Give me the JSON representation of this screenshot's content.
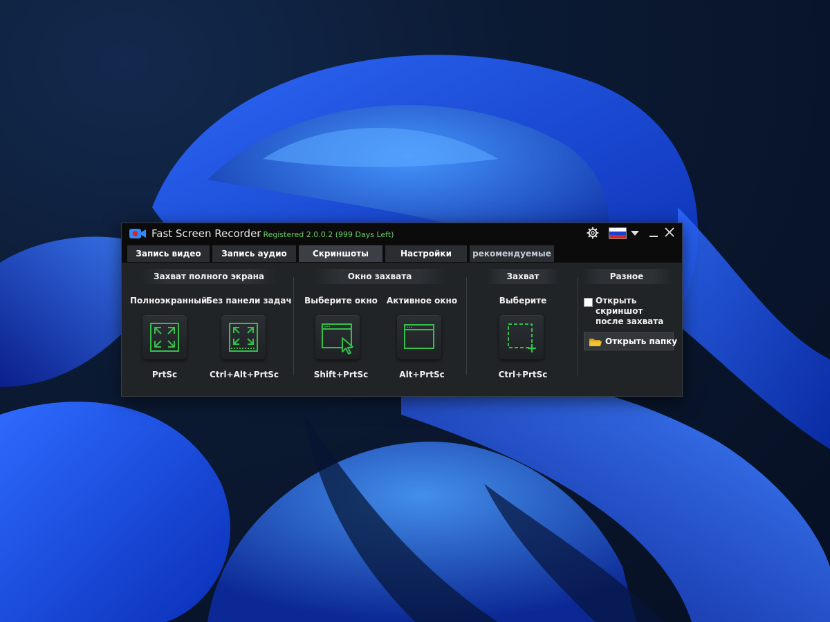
{
  "app": {
    "title": "Fast Screen Recorder",
    "registration": "- Registered 2.0.0.2 (999 Days Left)",
    "language": "Russian"
  },
  "tabs": [
    {
      "label": "Запись видео",
      "active": false
    },
    {
      "label": "Запись аудио",
      "active": false
    },
    {
      "label": "Скриншоты",
      "active": true
    },
    {
      "label": "Настройки",
      "active": false
    },
    {
      "label": "рекомендуемые",
      "active": false
    }
  ],
  "sections": {
    "fullscreen": {
      "heading": "Захват полного экрана",
      "items": [
        {
          "label": "Полноэкранный",
          "hotkey": "PrtSc",
          "icon": "fullscreen-expand-icon"
        },
        {
          "label": "Без панели задач",
          "hotkey": "Ctrl+Alt+PrtSc",
          "icon": "fullscreen-no-taskbar-icon"
        }
      ]
    },
    "window": {
      "heading": "Окно захвата",
      "items": [
        {
          "label": "Выберите окно",
          "hotkey": "Shift+PrtSc",
          "icon": "select-window-icon"
        },
        {
          "label": "Активное окно",
          "hotkey": "Alt+PrtSc",
          "icon": "active-window-icon"
        }
      ]
    },
    "region": {
      "heading": "Захват",
      "items": [
        {
          "label": "Выберите",
          "hotkey": "Ctrl+PrtSc",
          "icon": "select-region-icon"
        }
      ]
    },
    "misc": {
      "heading": "Разное",
      "open_after_capture_label": "Открыть скриншот после захвата",
      "open_after_capture_checked": false,
      "open_folder_label": "Открыть папку"
    }
  },
  "colors": {
    "accent_green": "#35c04a",
    "registration_green": "#6ad16a",
    "window_bg": "#212427",
    "titlebar_bg": "#0b0b0c"
  }
}
